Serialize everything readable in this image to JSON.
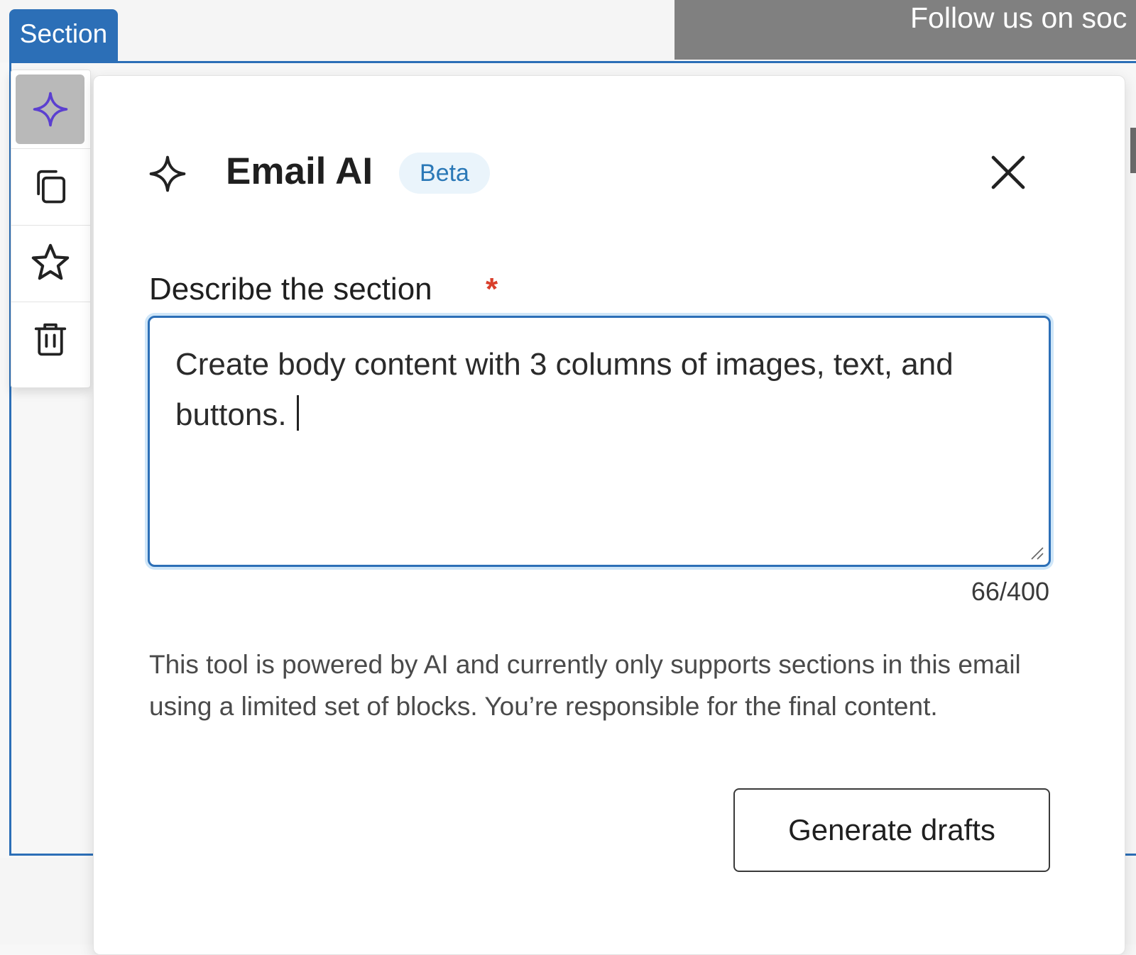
{
  "canvas": {
    "section_tag": "Section",
    "social_banner_text": "Follow us on soc"
  },
  "toolbar": {
    "items": [
      {
        "name": "ai-sparkle",
        "icon": "sparkle-icon",
        "active": true
      },
      {
        "name": "duplicate",
        "icon": "duplicate-icon",
        "active": false
      },
      {
        "name": "favorite",
        "icon": "star-icon",
        "active": false
      },
      {
        "name": "delete",
        "icon": "trash-icon",
        "active": false
      }
    ]
  },
  "panel": {
    "title": "Email AI",
    "badge": "Beta",
    "field_label": "Describe the section",
    "required_mark": "*",
    "textarea_value": "Create body content with 3 columns of images, text, and buttons.",
    "char_count": "66/400",
    "disclaimer": "This tool is powered by AI and currently only supports sections in this email using a limited set of blocks. You’re responsible for the final content.",
    "generate_button": "Generate drafts"
  },
  "colors": {
    "accent_blue": "#2c6fb7",
    "sparkle_purple": "#5b3fd0",
    "required_red": "#d93f2b",
    "badge_bg": "#eaf4fb",
    "badge_text": "#2a78b7",
    "banner_gray": "#808080"
  }
}
